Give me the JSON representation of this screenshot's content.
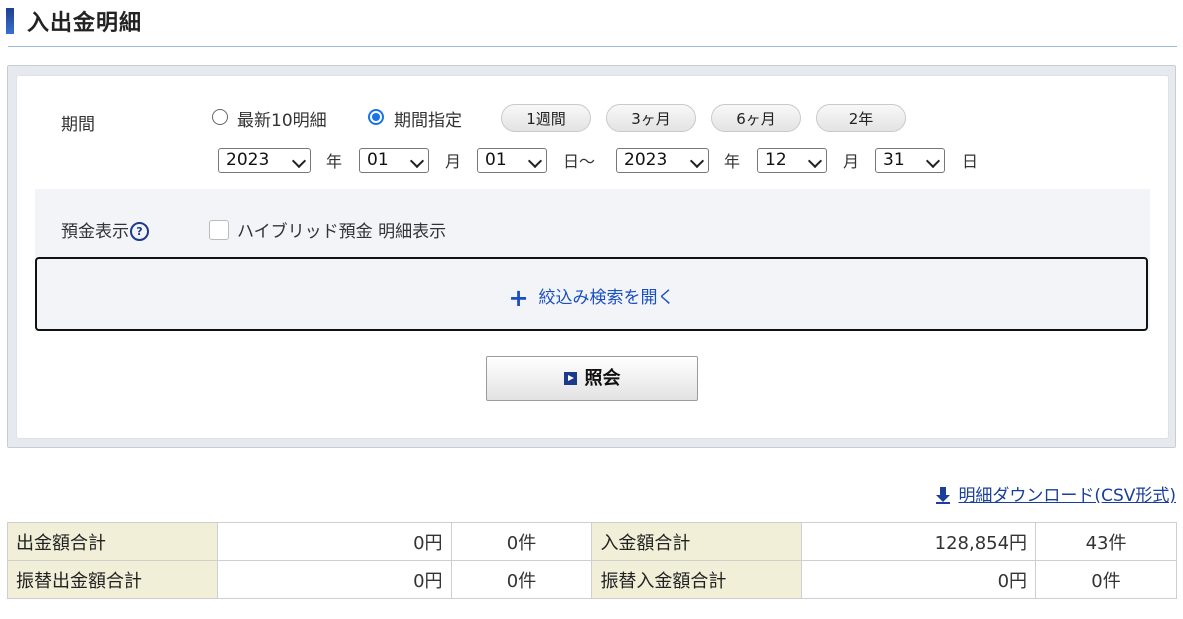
{
  "page": {
    "title": "入出金明細"
  },
  "form": {
    "period_label": "期間",
    "radio_latest": "最新10明細",
    "radio_range": "期間指定",
    "range_selected": true,
    "quick_buttons": [
      "1週間",
      "3ヶ月",
      "6ヶ月",
      "2年"
    ],
    "from": {
      "year": "2023",
      "month": "01",
      "day": "01"
    },
    "to": {
      "year": "2023",
      "month": "12",
      "day": "31"
    },
    "unit_year": "年",
    "unit_month": "月",
    "unit_day_range": "日～",
    "unit_day": "日",
    "deposit_label": "預金表示",
    "help_mark": "?",
    "hybrid_checkbox_label": "ハイブリッド預金 明細表示",
    "hybrid_checked": false,
    "expand_search": "絞込み検索を開く",
    "expand_plus": "+",
    "submit": "照会"
  },
  "download": {
    "label": "明細ダウンロード(CSV形式)"
  },
  "summary": {
    "rows": [
      {
        "left_label": "出金額合計",
        "left_amount": "0円",
        "left_count": "0件",
        "right_label": "入金額合計",
        "right_amount": "128,854円",
        "right_count": "43件"
      },
      {
        "left_label": "振替出金額合計",
        "left_amount": "0円",
        "left_count": "0件",
        "right_label": "振替入金額合計",
        "right_amount": "0円",
        "right_count": "0件"
      }
    ]
  }
}
